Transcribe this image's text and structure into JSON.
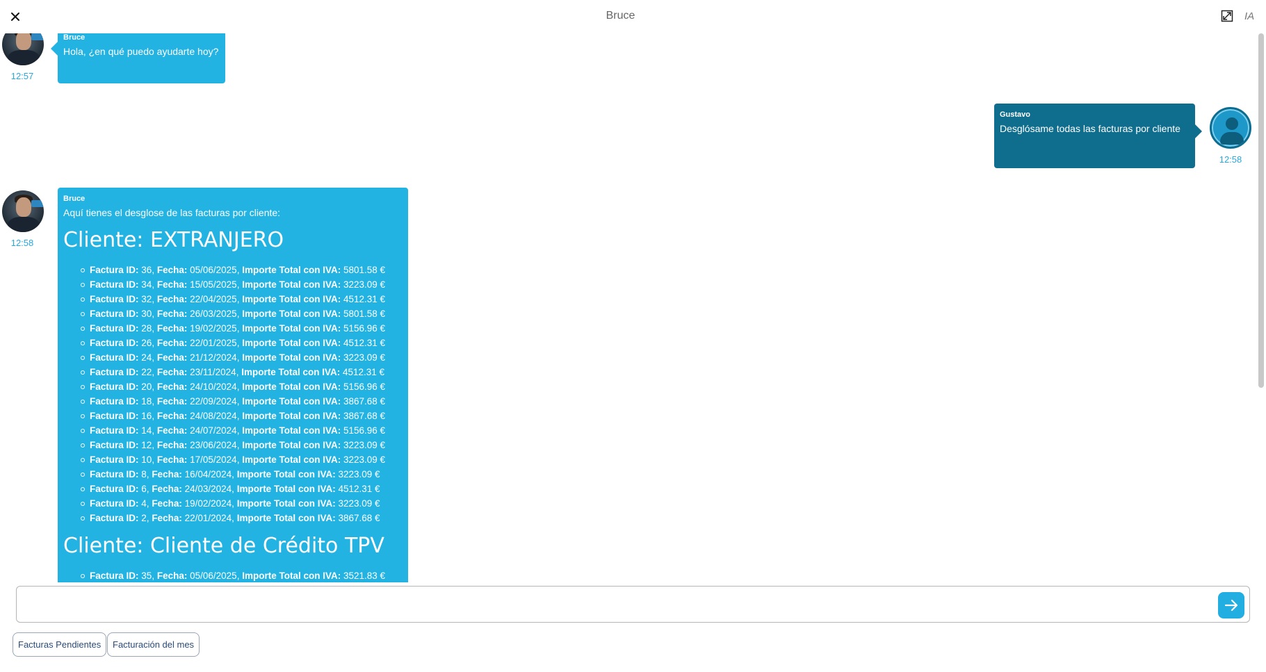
{
  "header": {
    "title": "Bruce",
    "ia_label": "IA",
    "close_icon": "close-icon",
    "expand_icon": "expand-icon"
  },
  "messages": [
    {
      "sender": "Bruce",
      "text": "Hola, ¿en qué puedo ayudarte hoy?",
      "time": "12:57"
    },
    {
      "sender": "Gustavo",
      "text": "Desglósame todas las facturas por cliente",
      "time": "12:58"
    },
    {
      "sender": "Bruce",
      "intro": "Aquí tienes el desglose de las facturas por cliente:",
      "time": "12:58",
      "clients": [
        {
          "heading": "Cliente: EXTRANJERO",
          "invoices": [
            {
              "id": "36",
              "fecha": "05/06/2025",
              "importe": "5801.58 €"
            },
            {
              "id": "34",
              "fecha": "15/05/2025",
              "importe": "3223.09 €"
            },
            {
              "id": "32",
              "fecha": "22/04/2025",
              "importe": "4512.31 €"
            },
            {
              "id": "30",
              "fecha": "26/03/2025",
              "importe": "5801.58 €"
            },
            {
              "id": "28",
              "fecha": "19/02/2025",
              "importe": "5156.96 €"
            },
            {
              "id": "26",
              "fecha": "22/01/2025",
              "importe": "4512.31 €"
            },
            {
              "id": "24",
              "fecha": "21/12/2024",
              "importe": "3223.09 €"
            },
            {
              "id": "22",
              "fecha": "23/11/2024",
              "importe": "4512.31 €"
            },
            {
              "id": "20",
              "fecha": "24/10/2024",
              "importe": "5156.96 €"
            },
            {
              "id": "18",
              "fecha": "22/09/2024",
              "importe": "3867.68 €"
            },
            {
              "id": "16",
              "fecha": "24/08/2024",
              "importe": "3867.68 €"
            },
            {
              "id": "14",
              "fecha": "24/07/2024",
              "importe": "5156.96 €"
            },
            {
              "id": "12",
              "fecha": "23/06/2024",
              "importe": "3223.09 €"
            },
            {
              "id": "10",
              "fecha": "17/05/2024",
              "importe": "3223.09 €"
            },
            {
              "id": "8",
              "fecha": "16/04/2024",
              "importe": "3223.09 €"
            },
            {
              "id": "6",
              "fecha": "24/03/2024",
              "importe": "4512.31 €"
            },
            {
              "id": "4",
              "fecha": "19/02/2024",
              "importe": "3223.09 €"
            },
            {
              "id": "2",
              "fecha": "22/01/2024",
              "importe": "3867.68 €"
            }
          ]
        },
        {
          "heading": "Cliente: Cliente de Crédito TPV",
          "invoices": [
            {
              "id": "35",
              "fecha": "05/06/2025",
              "importe": "3521.83 €"
            }
          ]
        }
      ]
    }
  ],
  "labels": {
    "factura_id": "Factura ID:",
    "fecha": "Fecha:",
    "importe": "Importe Total con IVA:"
  },
  "composer": {
    "placeholder": "",
    "send_icon": "arrow-right-icon"
  },
  "suggestions": [
    "Facturas Pendientes",
    "Facturación del mes"
  ],
  "colors": {
    "bot_bubble": "#22b3e2",
    "user_bubble": "#0f6e8e",
    "time": "#29a8d9"
  }
}
